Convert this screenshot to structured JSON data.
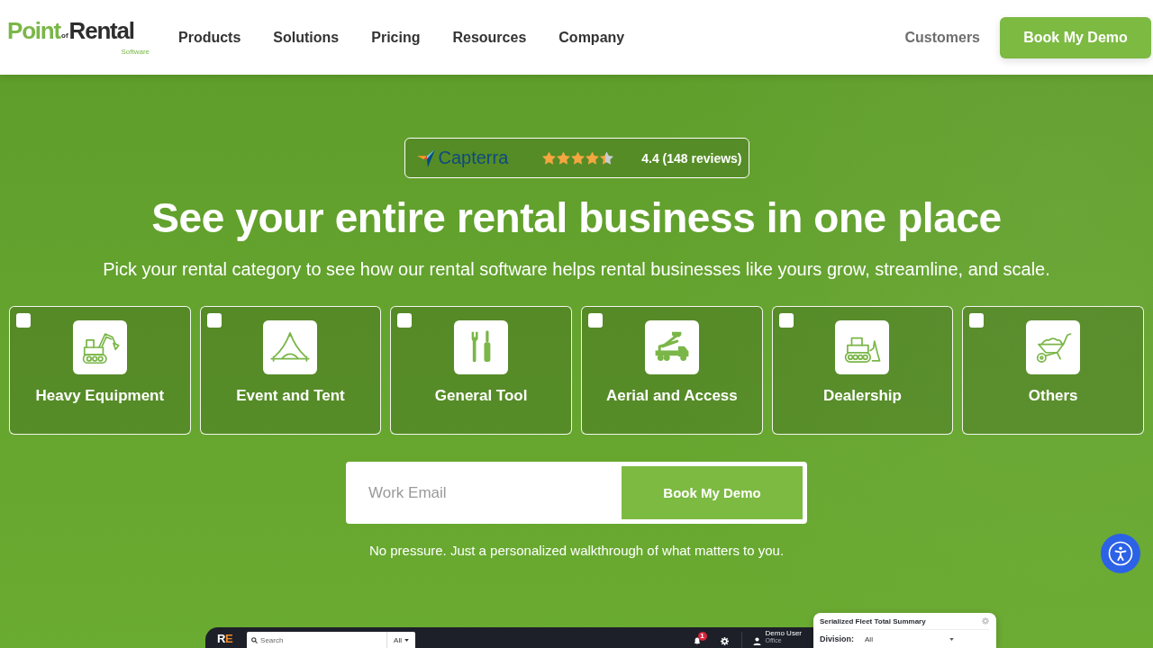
{
  "header": {
    "logo": {
      "name_start": "Point",
      "connector": "of",
      "name_end": "Rental",
      "tagline": "Software"
    },
    "nav": [
      {
        "label": "Products"
      },
      {
        "label": "Solutions"
      },
      {
        "label": "Pricing"
      },
      {
        "label": "Resources"
      },
      {
        "label": "Company"
      }
    ],
    "customers_link": "Customers",
    "cta_button": "Book My Demo"
  },
  "hero": {
    "rating_badge": {
      "brand": "Capterra",
      "stars": 4.4,
      "rating": "4.4 (148 reviews)"
    },
    "title": "See your entire rental business in one place",
    "subtitle": "Pick your rental category to see how our rental software helps rental businesses like yours grow, streamline, and scale.",
    "categories": [
      {
        "label": "Heavy Equipment",
        "checked": false
      },
      {
        "label": "Event and Tent",
        "checked": false
      },
      {
        "label": "General Tool",
        "checked": false
      },
      {
        "label": "Aerial and Access",
        "checked": false
      },
      {
        "label": "Dealership",
        "checked": false
      },
      {
        "label": "Others",
        "checked": false
      }
    ],
    "email_form": {
      "placeholder": "Work Email",
      "button": "Book My Demo"
    },
    "note": "No pressure. Just a personalized walkthrough of what matters to you."
  },
  "app_preview": {
    "logo": "RE",
    "search": {
      "placeholder": "Search",
      "filter": "All"
    },
    "notification_count": "1",
    "user": {
      "name": "Demo User",
      "role": "Office"
    },
    "summary_card": {
      "title": "Serialized Fleet Total Summary",
      "filter_label": "Division:",
      "filter_value": "All"
    }
  }
}
